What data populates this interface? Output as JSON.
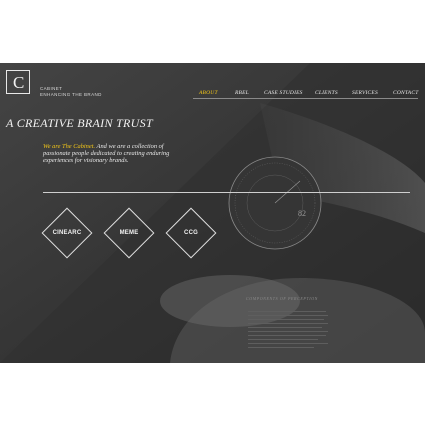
{
  "brand": {
    "logo_glyph": "C",
    "line1": "CABINET",
    "line2": "ENHANCING THE BRAND"
  },
  "nav": {
    "items": [
      {
        "label": "ABOUT",
        "active": true
      },
      {
        "label": "RBEL",
        "active": false
      },
      {
        "label": "CASE STUDIES",
        "active": false
      },
      {
        "label": "CLIENTS",
        "active": false
      },
      {
        "label": "SERVICES",
        "active": false
      },
      {
        "label": "CONTACT",
        "active": false
      }
    ]
  },
  "hero": {
    "headline": "A CREATIVE BRAIN TRUST",
    "intro_highlight": "We are The Cabinet.",
    "intro_rest": " And we are a collection of passionate people dedicated to creating enduring experiences for visionary brands."
  },
  "diamonds": [
    {
      "label": "CINEARC"
    },
    {
      "label": "MEME"
    },
    {
      "label": "CCG"
    }
  ],
  "background": {
    "dial_number": "82",
    "caption": "COMPONENTS OF PERCEPTION"
  },
  "colors": {
    "accent": "#f0c419",
    "panel": "#3b3b3b",
    "text": "#f2f2f2"
  }
}
